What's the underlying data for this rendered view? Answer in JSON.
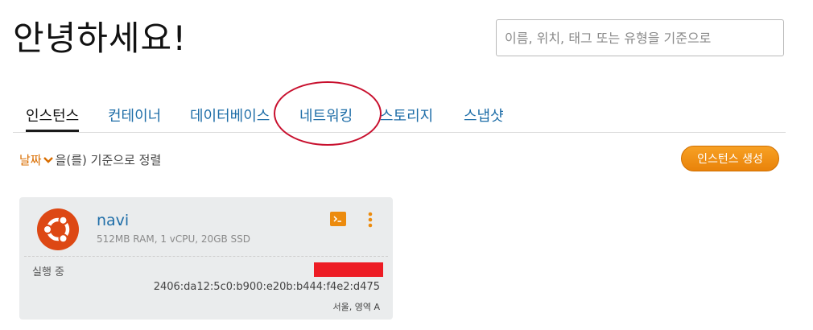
{
  "header": {
    "greeting": "안녕하세요!",
    "search_placeholder": "이름, 위치, 태그 또는 유형을 기준으로"
  },
  "tabs": [
    {
      "label": "인스턴스",
      "active": true
    },
    {
      "label": "컨테이너",
      "active": false
    },
    {
      "label": "데이터베이스",
      "active": false
    },
    {
      "label": "네트워킹",
      "active": false
    },
    {
      "label": "스토리지",
      "active": false
    },
    {
      "label": "스냅샷",
      "active": false
    }
  ],
  "sort": {
    "field_label": "날짜",
    "suffix": "을(를) 기준으로 정렬"
  },
  "actions": {
    "create_label": "인스턴스 생성"
  },
  "instance": {
    "name": "navi",
    "spec": "512MB RAM, 1 vCPU, 20GB SSD",
    "status": "실행 중",
    "ipv6": "2406:da12:5c0:b900:e20b:b444:f4e2:d475",
    "region": "서울, 영역 A",
    "os_icon": "ubuntu-logo-icon",
    "terminal_icon": "terminal-icon",
    "more_icon": "vertical-ellipsis-icon"
  },
  "colors": {
    "accent_orange": "#ec8b0e",
    "link_blue": "#1f6ea8",
    "annotation_red": "#c8102e",
    "redaction_red": "#ed1c24",
    "ubuntu_orange": "#dd4814"
  }
}
